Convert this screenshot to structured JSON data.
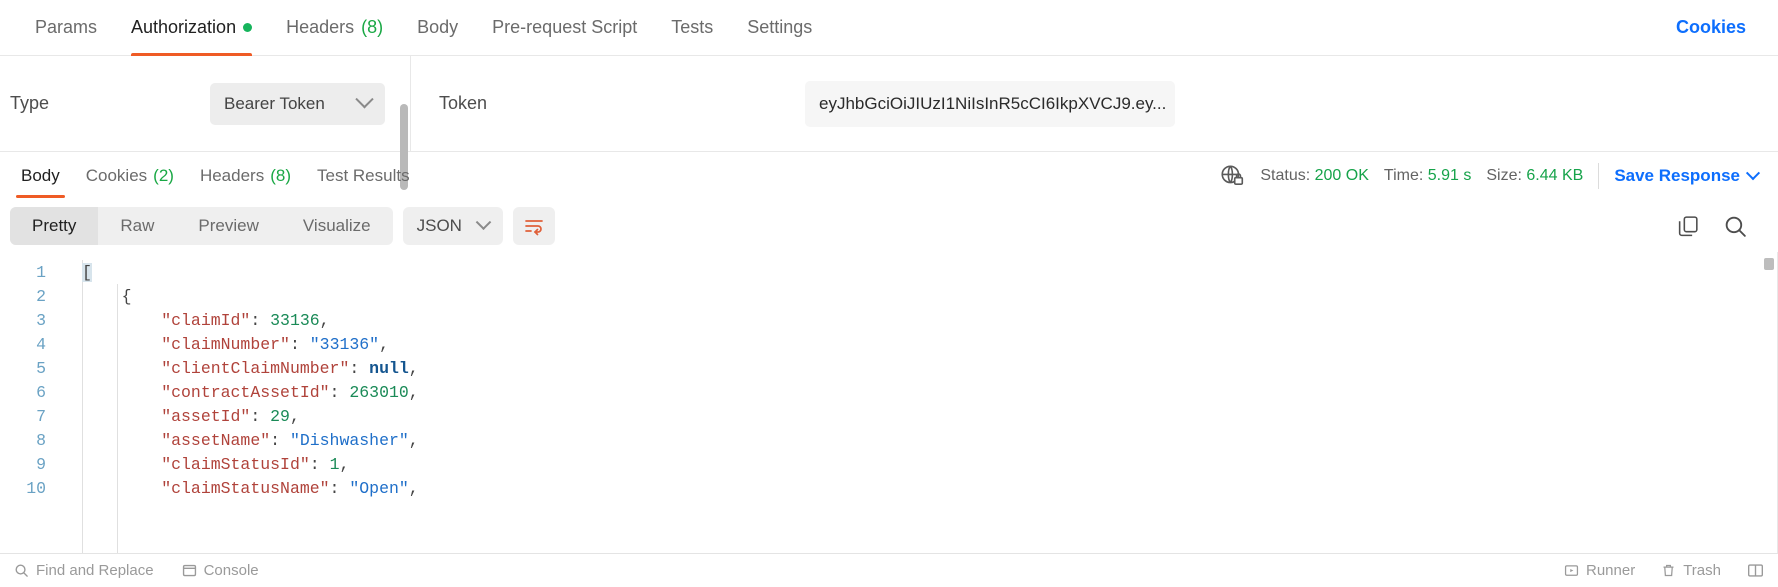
{
  "request_tabs": {
    "items": [
      {
        "label": "Params",
        "count": null,
        "active": false,
        "dot": false
      },
      {
        "label": "Authorization",
        "count": null,
        "active": true,
        "dot": true
      },
      {
        "label": "Headers",
        "count": "(8)",
        "active": false,
        "dot": false
      },
      {
        "label": "Body",
        "count": null,
        "active": false,
        "dot": false
      },
      {
        "label": "Pre-request Script",
        "count": null,
        "active": false,
        "dot": false
      },
      {
        "label": "Tests",
        "count": null,
        "active": false,
        "dot": false
      },
      {
        "label": "Settings",
        "count": null,
        "active": false,
        "dot": false
      }
    ],
    "cookies_label": "Cookies"
  },
  "authorization": {
    "type_label": "Type",
    "type_value": "Bearer Token",
    "token_label": "Token",
    "token_value": "eyJhbGciOiJIUzI1NiIsInR5cCI6IkpXVCJ9.ey..."
  },
  "response_tabs": {
    "items": [
      {
        "label": "Body",
        "count": null,
        "active": true
      },
      {
        "label": "Cookies",
        "count": "(2)",
        "active": false
      },
      {
        "label": "Headers",
        "count": "(8)",
        "active": false
      },
      {
        "label": "Test Results",
        "count": null,
        "active": false
      }
    ],
    "status_label": "Status:",
    "status_value": "200 OK",
    "time_label": "Time:",
    "time_value": "5.91 s",
    "size_label": "Size:",
    "size_value": "6.44 KB",
    "save_response_label": "Save Response"
  },
  "viewer": {
    "modes": [
      {
        "label": "Pretty",
        "active": true
      },
      {
        "label": "Raw",
        "active": false
      },
      {
        "label": "Preview",
        "active": false
      },
      {
        "label": "Visualize",
        "active": false
      }
    ],
    "format_value": "JSON",
    "wrap_icon": "wrap-lines-icon",
    "copy_icon": "copy-icon",
    "search_icon": "search-icon"
  },
  "code": {
    "lines": [
      {
        "n": "1",
        "tokens": [
          {
            "t": "[",
            "c": "brk sel"
          }
        ]
      },
      {
        "n": "2",
        "tokens": [
          {
            "t": "    {",
            "c": "brk"
          }
        ]
      },
      {
        "n": "3",
        "tokens": [
          {
            "t": "        ",
            "c": "punct"
          },
          {
            "t": "\"claimId\"",
            "c": "key"
          },
          {
            "t": ": ",
            "c": "punct"
          },
          {
            "t": "33136",
            "c": "num"
          },
          {
            "t": ",",
            "c": "punct"
          }
        ]
      },
      {
        "n": "4",
        "tokens": [
          {
            "t": "        ",
            "c": "punct"
          },
          {
            "t": "\"claimNumber\"",
            "c": "key"
          },
          {
            "t": ": ",
            "c": "punct"
          },
          {
            "t": "\"33136\"",
            "c": "str"
          },
          {
            "t": ",",
            "c": "punct"
          }
        ]
      },
      {
        "n": "5",
        "tokens": [
          {
            "t": "        ",
            "c": "punct"
          },
          {
            "t": "\"clientClaimNumber\"",
            "c": "key"
          },
          {
            "t": ": ",
            "c": "punct"
          },
          {
            "t": "null",
            "c": "null"
          },
          {
            "t": ",",
            "c": "punct"
          }
        ]
      },
      {
        "n": "6",
        "tokens": [
          {
            "t": "        ",
            "c": "punct"
          },
          {
            "t": "\"contractAssetId\"",
            "c": "key"
          },
          {
            "t": ": ",
            "c": "punct"
          },
          {
            "t": "263010",
            "c": "num"
          },
          {
            "t": ",",
            "c": "punct"
          }
        ]
      },
      {
        "n": "7",
        "tokens": [
          {
            "t": "        ",
            "c": "punct"
          },
          {
            "t": "\"assetId\"",
            "c": "key"
          },
          {
            "t": ": ",
            "c": "punct"
          },
          {
            "t": "29",
            "c": "num"
          },
          {
            "t": ",",
            "c": "punct"
          }
        ]
      },
      {
        "n": "8",
        "tokens": [
          {
            "t": "        ",
            "c": "punct"
          },
          {
            "t": "\"assetName\"",
            "c": "key"
          },
          {
            "t": ": ",
            "c": "punct"
          },
          {
            "t": "\"Dishwasher\"",
            "c": "str"
          },
          {
            "t": ",",
            "c": "punct"
          }
        ]
      },
      {
        "n": "9",
        "tokens": [
          {
            "t": "        ",
            "c": "punct"
          },
          {
            "t": "\"claimStatusId\"",
            "c": "key"
          },
          {
            "t": ": ",
            "c": "punct"
          },
          {
            "t": "1",
            "c": "num"
          },
          {
            "t": ",",
            "c": "punct"
          }
        ]
      },
      {
        "n": "10",
        "tokens": [
          {
            "t": "        ",
            "c": "punct"
          },
          {
            "t": "\"claimStatusName\"",
            "c": "key"
          },
          {
            "t": ": ",
            "c": "punct"
          },
          {
            "t": "\"Open\"",
            "c": "str"
          },
          {
            "t": ",",
            "c": "punct"
          }
        ]
      }
    ]
  },
  "statusbar": {
    "find_replace_label": "Find and Replace",
    "console_label": "Console",
    "runner_label": "Runner",
    "trash_label": "Trash"
  }
}
